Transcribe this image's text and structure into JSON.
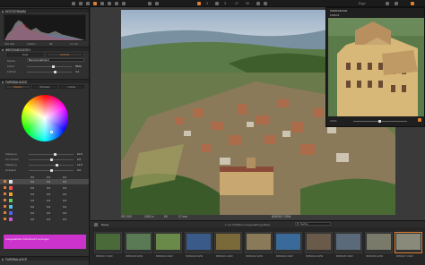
{
  "topbar": {
    "right_label": "Ergo",
    "center_counts": [
      "3",
      "3",
      "17",
      "39"
    ]
  },
  "left_panel": {
    "histogram_title": "HISTOGRAMM",
    "histo_iso": "ISO 200",
    "histo_shutter": "1/200 s",
    "histo_aperture": "f/8",
    "histo_focal": "17 mm",
    "wb_title": "WEISSABGLEICH",
    "wb_tabs": [
      "Gras",
      "Neutral"
    ],
    "wb_mode_label": "Modus",
    "wb_mode_value": "Benutzerdefiniert",
    "wb_rows": [
      {
        "label": "Kelvin",
        "value": "5600"
      },
      {
        "label": "Farbton",
        "value": "4.2"
      }
    ],
    "cb_title": "FARBBALANCE",
    "cb_tabs": [
      "Master",
      "Schatten",
      "Lichter"
    ],
    "cb_rows": [
      {
        "label": "Sättigung",
        "value": "10.6"
      },
      {
        "label": "Ton drehen",
        "value": "0.0"
      },
      {
        "label": "Sättigung",
        "value": "12.6"
      },
      {
        "label": "Helligkeit",
        "value": "0.0"
      }
    ],
    "cb_list_headers": [
      "",
      "0.0",
      "0.0",
      "0.0"
    ],
    "cb_list": [
      {
        "color": "#e0e0e0",
        "vals": [
          "0.0",
          "0.0",
          "0.0"
        ]
      },
      {
        "color": "#ff5050",
        "vals": [
          "0.0",
          "0.0",
          "0.0"
        ]
      },
      {
        "color": "#f0a030",
        "vals": [
          "0.0",
          "0.0",
          "0.0"
        ]
      },
      {
        "color": "#60d060",
        "vals": [
          "0.0",
          "0.0",
          "0.0"
        ]
      },
      {
        "color": "#50c0e0",
        "vals": [
          "0.0",
          "0.0",
          "0.0"
        ]
      },
      {
        "color": "#5060ff",
        "vals": [
          "0.0",
          "0.0",
          "0.0"
        ]
      },
      {
        "color": "#d050d0",
        "vals": [
          "0.0",
          "0.0",
          "0.0"
        ]
      }
    ],
    "mask_label": "Ausgewählten Farbbereich anzeigen",
    "bottom_title": "FARBBALANCE"
  },
  "viewer": {
    "meta": {
      "iso": "ISO 200",
      "shutter": "1/200 s",
      "aperture": "f/8",
      "focal": "17 mm",
      "filename": "B050307.CRW"
    },
    "focus_title": "FOKUS",
    "focus_header": "WERKZEUGE",
    "focus_zoom": "100%"
  },
  "browser": {
    "sort_label": "Name",
    "status": "1 von 54 Bildern ausgewählt (gefiltert)",
    "search_placeholder": "Suche",
    "thumbs": [
      {
        "name": "B050317.CRW",
        "color": "#4a6a3a"
      },
      {
        "name": "B050318.CRW",
        "color": "#5a7a55"
      },
      {
        "name": "B050319.CRW",
        "color": "#6a8a4a"
      },
      {
        "name": "B050320.CRW",
        "color": "#3a5a8a"
      },
      {
        "name": "B050321.CRW",
        "color": "#7a6a3a"
      },
      {
        "name": "B050322.CRW",
        "color": "#8a7a5a"
      },
      {
        "name": "B050323.CRW",
        "color": "#3a6a9a"
      },
      {
        "name": "B050324.CRW",
        "color": "#6a5a4a"
      },
      {
        "name": "B050325.CRW",
        "color": "#5a6a7a"
      },
      {
        "name": "B050326.CRW",
        "color": "#7a7a6a"
      },
      {
        "name": "B050327.CRW",
        "color": "#8a8a7a"
      }
    ]
  }
}
